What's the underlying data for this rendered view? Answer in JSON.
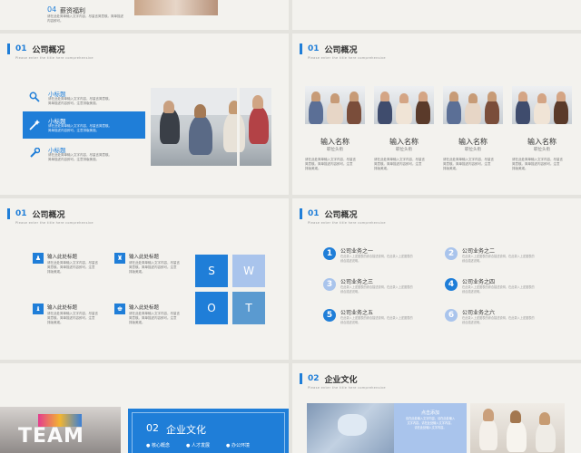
{
  "colors": {
    "accent": "#1f7ed8",
    "light_blue": "#a9c4ec",
    "bg": "#f3f2ee"
  },
  "top_strip": {
    "num": "04",
    "title": "薪资福利",
    "lines": [
      "请在此处简单输入文字内容，",
      "尽量言简意赅。简单描述",
      "内容即可。"
    ]
  },
  "slide1": {
    "num": "01",
    "title": "公司概况",
    "subtitle": "Please enter the title here comprehensive",
    "items": [
      {
        "title": "小标题",
        "text": [
          "请在此处简单输入文字内容，尽量言简意赅。",
          "简单描述内容即可。注意排版美观。"
        ],
        "icon": "search-icon"
      },
      {
        "title": "小标题",
        "text": [
          "请在此处简单输入文字内容，尽量言简意赅。",
          "简单描述内容即可。注意排版美观。"
        ],
        "icon": "magic-wand-icon"
      },
      {
        "title": "小标题",
        "text": [
          "请在此处简单输入文字内容，尽量言简意赅。",
          "简单描述内容即可。注意排版美观。"
        ],
        "icon": "wrench-icon"
      }
    ]
  },
  "slide2": {
    "num": "01",
    "title": "公司概况",
    "subtitle": "Please enter the title here comprehensive",
    "members": [
      {
        "name": "输入名称",
        "role": "职位头衔",
        "text": [
          "请在此处简单输入文字内容，尽量言",
          "简意赅。简单描述内容即可。注意",
          "排版美观。"
        ]
      },
      {
        "name": "输入名称",
        "role": "职位头衔",
        "text": [
          "请在此处简单输入文字内容，尽量言",
          "简意赅。简单描述内容即可。注意",
          "排版美观。"
        ]
      },
      {
        "name": "输入名称",
        "role": "职位头衔",
        "text": [
          "请在此处简单输入文字内容，尽量言",
          "简意赅。简单描述内容即可。注意",
          "排版美观。"
        ]
      },
      {
        "name": "输入名称",
        "role": "职位头衔",
        "text": [
          "请在此处简单输入文字内容，尽量言",
          "简意赅。简单描述内容即可。注意",
          "排版美观。"
        ]
      }
    ]
  },
  "slide3": {
    "num": "01",
    "title": "公司概况",
    "subtitle": "Please enter the title here comprehensive",
    "items": [
      {
        "title": "输入此处标题",
        "text": [
          "请在此处简单输入文字内容，尽量言",
          "简意赅。简单描述内容即可。注意",
          "排版美观。"
        ]
      },
      {
        "title": "输入此处标题",
        "text": [
          "请在此处简单输入文字内容，尽量言",
          "简意赅。简单描述内容即可。注意",
          "排版美观。"
        ]
      },
      {
        "title": "输入此处标题",
        "text": [
          "请在此处简单输入文字内容，尽量言",
          "简意赅。简单描述内容即可。注意",
          "排版美观。"
        ]
      },
      {
        "title": "输入此处标题",
        "text": [
          "请在此处简单输入文字内容，尽量言",
          "简意赅。简单描述内容即可。注意",
          "排版美观。"
        ]
      }
    ],
    "swot": [
      "S",
      "W",
      "O",
      "T"
    ]
  },
  "slide4": {
    "num": "01",
    "title": "公司概况",
    "subtitle": "Please enter the title here comprehensive",
    "items": [
      {
        "n": "1",
        "title": "公司业务之一",
        "text": [
          "在此录入上述图表的综合描述说明，在此录入上述图表的",
          "综合描述说明。"
        ]
      },
      {
        "n": "2",
        "title": "公司业务之二",
        "text": [
          "在此录入上述图表的综合描述说明，在此录入上述图表的",
          "综合描述说明。"
        ]
      },
      {
        "n": "3",
        "title": "公司业务之三",
        "text": [
          "在此录入上述图表的综合描述说明，在此录入上述图表的",
          "综合描述说明。"
        ]
      },
      {
        "n": "4",
        "title": "公司业务之四",
        "text": [
          "在此录入上述图表的综合描述说明，在此录入上述图表的",
          "综合描述说明。"
        ]
      },
      {
        "n": "5",
        "title": "公司业务之五",
        "text": [
          "在此录入上述图表的综合描述说明，在此录入上述图表的",
          "综合描述说明。"
        ]
      },
      {
        "n": "6",
        "title": "公司业务之六",
        "text": [
          "在此录入上述图表的综合描述说明，在此录入上述图表的",
          "综合描述说明。"
        ]
      }
    ]
  },
  "slide5": {
    "team": "TEAM",
    "num": "02",
    "title": "企业文化",
    "bullets": [
      "核心概念",
      "人才发展",
      "办公环境"
    ]
  },
  "slide6": {
    "num": "02",
    "title": "企业文化",
    "subtitle": "Please enter the title here comprehensive",
    "box_title": "点击添加",
    "box_lines": [
      "请在此处输入文字内容，请在此处输入",
      "文字内容，请在此处输入文字内容，",
      "请在此处输入文字内容。"
    ]
  }
}
